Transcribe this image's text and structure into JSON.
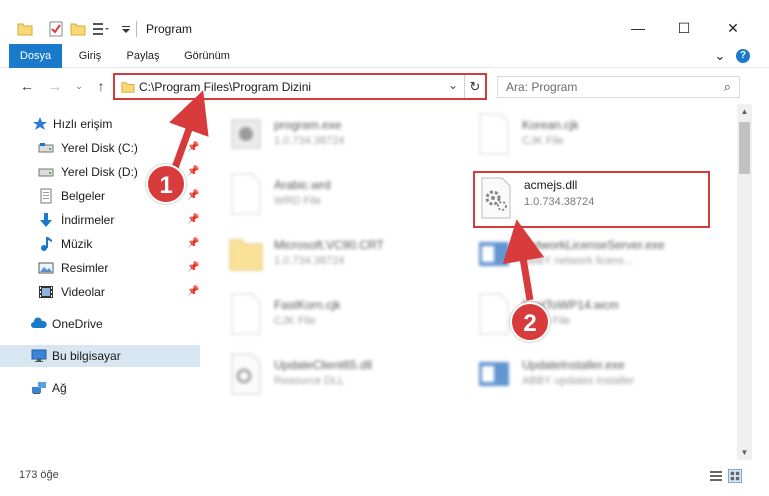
{
  "window": {
    "title": "Program",
    "buttons": {
      "minimize": "—",
      "maximize": "☐",
      "close": "✕"
    }
  },
  "ribbon": {
    "tabs": [
      "Dosya",
      "Giriş",
      "Paylaş",
      "Görünüm"
    ],
    "collapse": "⌄",
    "help": "?"
  },
  "address": {
    "path": "C:\\Program Files\\Program Dizini",
    "search_placeholder": "Ara: Program"
  },
  "sidebar": {
    "quick_access": "Hızlı erişim",
    "items": [
      {
        "label": "Yerel Disk (C:)",
        "icon": "drive-icon"
      },
      {
        "label": "Yerel Disk (D:)",
        "icon": "drive-icon"
      },
      {
        "label": "Belgeler",
        "icon": "documents-icon"
      },
      {
        "label": "İndirmeler",
        "icon": "download-icon"
      },
      {
        "label": "Müzik",
        "icon": "music-icon"
      },
      {
        "label": "Resimler",
        "icon": "pictures-icon"
      },
      {
        "label": "Videolar",
        "icon": "videos-icon"
      }
    ],
    "onedrive": "OneDrive",
    "this_pc": "Bu bilgisayar",
    "network": "Ağ"
  },
  "files": [
    {
      "name": "program.exe",
      "sub": "1.0.734.38724",
      "icon": "exe-icon"
    },
    {
      "name": "Korean.cjk",
      "sub": "CJK File",
      "icon": "generic-file-icon"
    },
    {
      "name": "Arabic.wrd",
      "sub": "WRD File",
      "icon": "generic-file-icon"
    },
    {
      "name": "acmejs.dll",
      "sub": "1.0.734.38724",
      "icon": "dll-icon"
    },
    {
      "name": "Microsoft.VC90.CRT",
      "sub": "1.0.734.38724",
      "icon": "folder-icon"
    },
    {
      "name": "NetworkLicenseServer.exe",
      "sub": "ABBY network licens...",
      "icon": "exe-icon"
    },
    {
      "name": "FastKorn.cjk",
      "sub": "CJK File",
      "icon": "generic-file-icon"
    },
    {
      "name": "FastToWP14.wcm",
      "sub": "WCM File",
      "icon": "generic-file-icon"
    },
    {
      "name": "UpdateClient65.dll",
      "sub": "Resource DLL",
      "icon": "dll-icon"
    },
    {
      "name": "UpdateInstaller.exe",
      "sub": "ABBY updates installer",
      "icon": "exe-icon"
    }
  ],
  "status": {
    "count": "173 öğe"
  },
  "annotations": {
    "step1": "1",
    "step2": "2"
  },
  "colors": {
    "accent": "#1979ca",
    "highlight": "#d33c3c",
    "callout": "#d83b3b"
  }
}
